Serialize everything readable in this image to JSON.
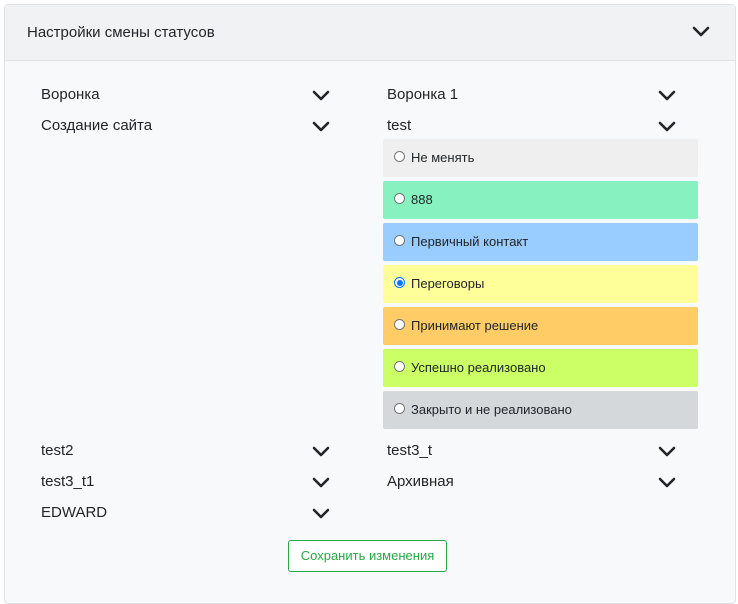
{
  "card": {
    "title": "Настройки смены статусов"
  },
  "rows": {
    "left": [
      "Воронка",
      "Создание сайта",
      "test2",
      "test3_t1",
      "EDWARD"
    ],
    "right": [
      "Воронка 1",
      "test",
      "test3_t",
      "Архивная"
    ]
  },
  "status_options": [
    {
      "label": "Не менять",
      "color": "#efefef",
      "checked": false
    },
    {
      "label": "888",
      "color": "#87f2c0",
      "checked": false
    },
    {
      "label": "Первичный контакт",
      "color": "#99ccff",
      "checked": false
    },
    {
      "label": "Переговоры",
      "color": "#ffff99",
      "checked": true
    },
    {
      "label": "Принимают решение",
      "color": "#ffcc66",
      "checked": false
    },
    {
      "label": "Успешно реализовано",
      "color": "#ccff66",
      "checked": false
    },
    {
      "label": "Закрыто и не реализовано",
      "color": "#d5d8db",
      "checked": false
    }
  ],
  "icons": {
    "chevron": "chevron-down-icon"
  },
  "actions": {
    "save_label": "Сохранить изменения"
  }
}
